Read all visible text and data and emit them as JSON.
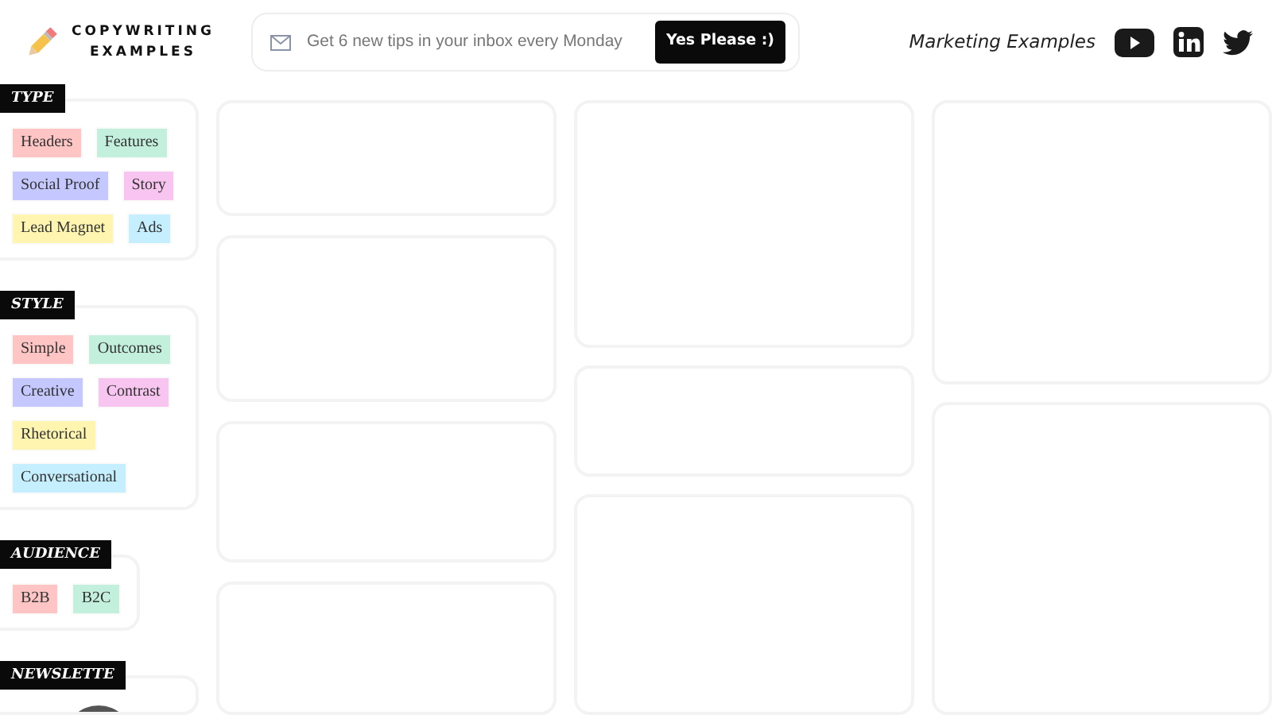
{
  "logo": {
    "lines": [
      "COPYWRITING",
      "EXAMPLES"
    ]
  },
  "subscribe": {
    "placeholder": "Get 6 new tips in your inbox every Monday",
    "button": "Yes Please :)"
  },
  "nav": {
    "link": "Marketing Examples"
  },
  "filters": [
    {
      "title": "TYPE",
      "tags": [
        {
          "label": "Headers",
          "color": "#ffc5c5"
        },
        {
          "label": "Features",
          "color": "#c2f0dc"
        },
        {
          "label": "Social Proof",
          "color": "#c5c8ff"
        },
        {
          "label": "Story",
          "color": "#f8c5f0"
        },
        {
          "label": "Lead Magnet",
          "color": "#fff5b0"
        },
        {
          "label": "Ads",
          "color": "#c5efff"
        }
      ]
    },
    {
      "title": "STYLE",
      "tags": [
        {
          "label": "Simple",
          "color": "#ffc5c5"
        },
        {
          "label": "Outcomes",
          "color": "#c2f0dc"
        },
        {
          "label": "Creative",
          "color": "#c5c8ff"
        },
        {
          "label": "Contrast",
          "color": "#f8c5f0"
        },
        {
          "label": "Rhetorical",
          "color": "#fff5b0"
        },
        {
          "label": "Conversational",
          "color": "#c5efff"
        }
      ]
    },
    {
      "title": "AUDIENCE",
      "tags": [
        {
          "label": "B2B",
          "color": "#ffc5c5"
        },
        {
          "label": "B2C",
          "color": "#c2f0dc"
        }
      ]
    }
  ],
  "newsletter": {
    "title": "NEWSLETTE"
  }
}
